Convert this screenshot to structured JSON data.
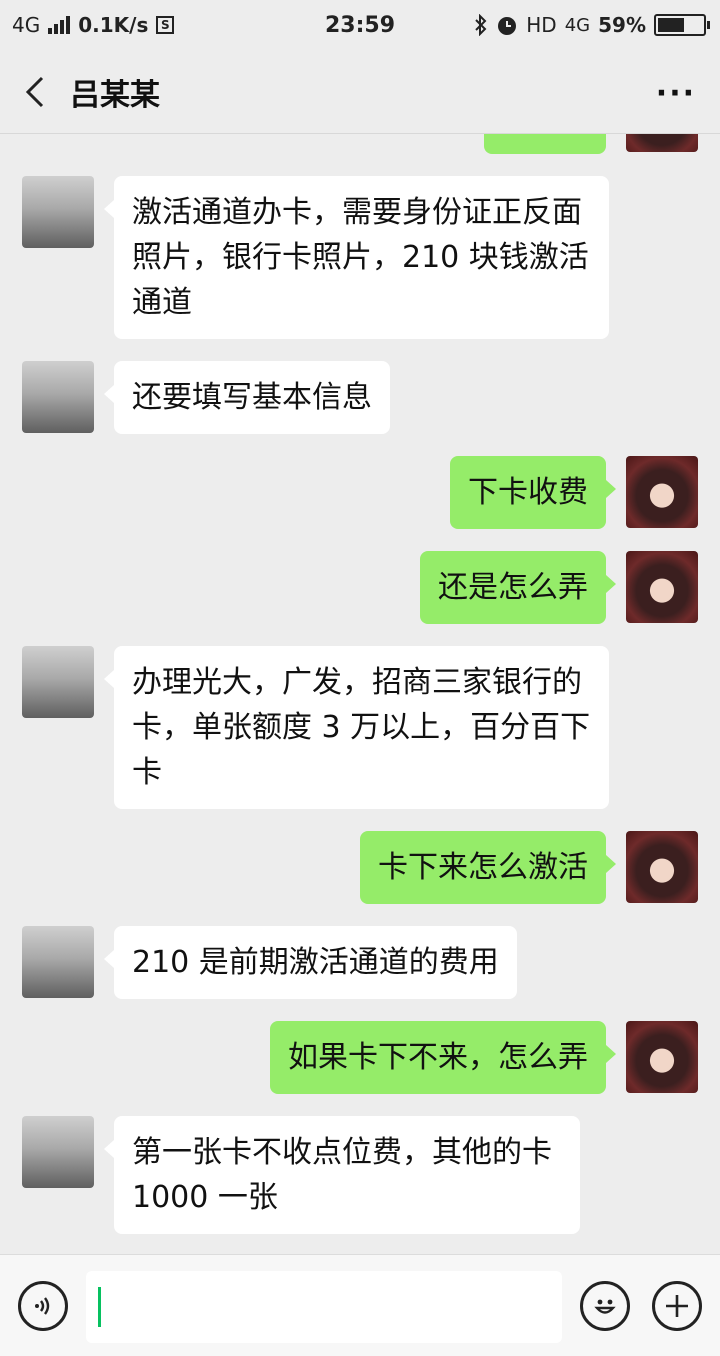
{
  "status_bar": {
    "network": "4G",
    "speed": "0.1K/s",
    "s_icon": "S",
    "time": "23:59",
    "hd": "HD",
    "network2": "4G",
    "battery": "59%",
    "battery_level": 0.59
  },
  "header": {
    "title": "吕某某"
  },
  "messages": [
    {
      "side": "other",
      "text": "激活通道办卡，需要身份证正反面照片，银行卡照片，210 块钱激活通道"
    },
    {
      "side": "other",
      "text": "还要填写基本信息"
    },
    {
      "side": "self",
      "text": "下卡收费"
    },
    {
      "side": "self",
      "text": "还是怎么弄"
    },
    {
      "side": "other",
      "text": "办理光大，广发，招商三家银行的卡，单张额度 3 万以上，百分百下卡"
    },
    {
      "side": "self",
      "text": "卡下来怎么激活"
    },
    {
      "side": "other",
      "text": "210 是前期激活通道的费用"
    },
    {
      "side": "self",
      "text": "如果卡下不来，怎么弄"
    },
    {
      "side": "other",
      "text": "第一张卡不收点位费，其他的卡 1000 一张"
    }
  ],
  "input": {
    "value": ""
  },
  "colors": {
    "self_bubble": "#95ec69",
    "other_bubble": "#ffffff",
    "background": "#ededed"
  },
  "icons": [
    "back-chevron-icon",
    "more-icon",
    "voice-icon",
    "emoji-icon",
    "plus-icon",
    "bluetooth-icon",
    "alarm-icon"
  ]
}
